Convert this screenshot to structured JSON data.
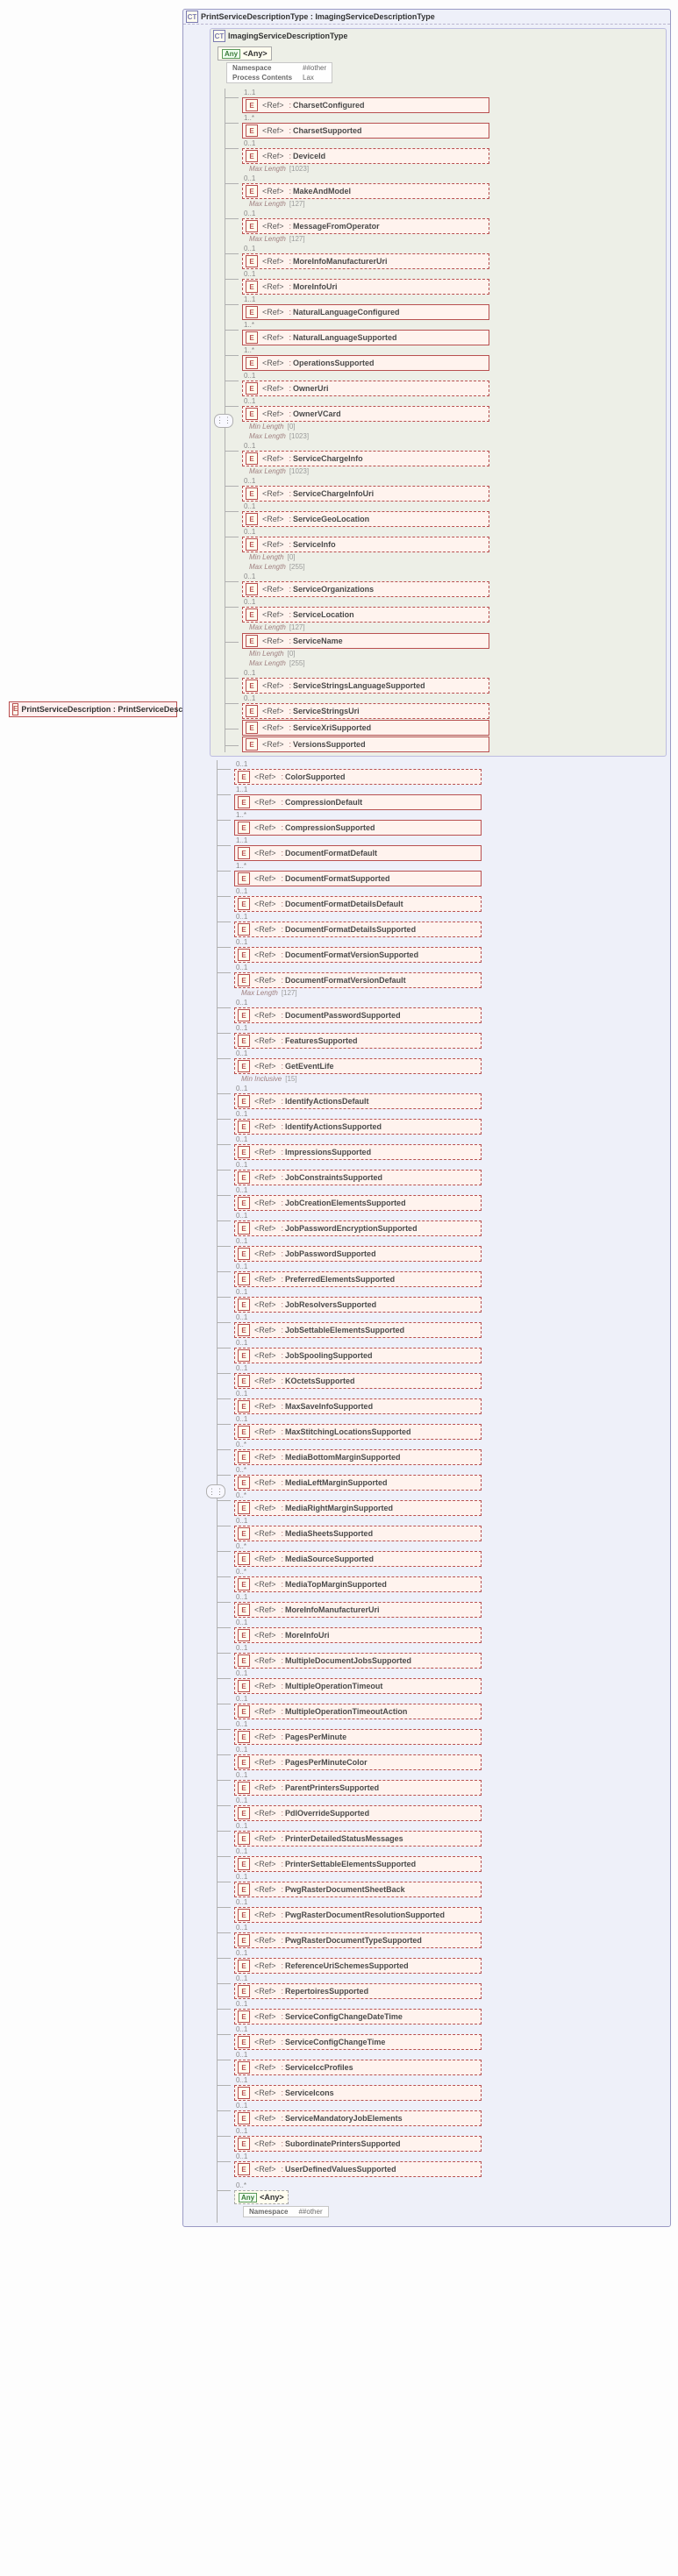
{
  "root": {
    "badge": "E",
    "label": "PrintServiceDescription : PrintServiceDescriptionType"
  },
  "outer_ct": {
    "badge": "CT",
    "title": "PrintServiceDescriptionType : ImagingServiceDescriptionType"
  },
  "inner_ct": {
    "badge": "CT",
    "title": "ImagingServiceDescriptionType"
  },
  "any_label": "<Any>",
  "any_badge": "Any",
  "ref_badge": "E",
  "ref_label": "<Ref>",
  "any_meta_top": [
    {
      "k": "Namespace",
      "v": "##other"
    },
    {
      "k": "Process Contents",
      "v": "Lax"
    }
  ],
  "any_meta_bottom": [
    {
      "k": "Namespace",
      "v": "##other"
    }
  ],
  "constraint_labels": {
    "max_length": "Max Length",
    "min_length": "Min Length",
    "min_inclusive": "Min Inclusive"
  },
  "inner_items": [
    {
      "occ": "1..1",
      "solid": true,
      "name": "CharsetConfigured"
    },
    {
      "occ": "1..*",
      "solid": true,
      "name": "CharsetSupported"
    },
    {
      "occ": "0..1",
      "solid": false,
      "name": "DeviceId",
      "constraints": [
        [
          "max_length",
          "[1023]"
        ]
      ]
    },
    {
      "occ": "0..1",
      "solid": false,
      "name": "MakeAndModel",
      "constraints": [
        [
          "max_length",
          "[127]"
        ]
      ]
    },
    {
      "occ": "0..1",
      "solid": false,
      "name": "MessageFromOperator",
      "constraints": [
        [
          "max_length",
          "[127]"
        ]
      ]
    },
    {
      "occ": "0..1",
      "solid": false,
      "name": "MoreInfoManufacturerUri"
    },
    {
      "occ": "0..1",
      "solid": false,
      "name": "MoreInfoUri"
    },
    {
      "occ": "1..1",
      "solid": true,
      "name": "NaturalLanguageConfigured"
    },
    {
      "occ": "1..*",
      "solid": true,
      "name": "NaturalLanguageSupported"
    },
    {
      "occ": "1..*",
      "solid": true,
      "name": "OperationsSupported"
    },
    {
      "occ": "0..1",
      "solid": false,
      "name": "OwnerUri"
    },
    {
      "occ": "0..1",
      "solid": false,
      "name": "OwnerVCard",
      "constraints": [
        [
          "min_length",
          "[0]"
        ],
        [
          "max_length",
          "[1023]"
        ]
      ]
    },
    {
      "occ": "0..1",
      "solid": false,
      "name": "ServiceChargeInfo",
      "constraints": [
        [
          "max_length",
          "[1023]"
        ]
      ]
    },
    {
      "occ": "0..1",
      "solid": false,
      "name": "ServiceChargeInfoUri"
    },
    {
      "occ": "0..1",
      "solid": false,
      "name": "ServiceGeoLocation"
    },
    {
      "occ": "0..1",
      "solid": false,
      "name": "ServiceInfo",
      "constraints": [
        [
          "min_length",
          "[0]"
        ],
        [
          "max_length",
          "[255]"
        ]
      ]
    },
    {
      "occ": "0..1",
      "solid": false,
      "name": "ServiceOrganizations"
    },
    {
      "occ": "0..1",
      "solid": false,
      "name": "ServiceLocation",
      "constraints": [
        [
          "max_length",
          "[127]"
        ]
      ]
    },
    {
      "occ": "",
      "solid": true,
      "name": "ServiceName",
      "constraints": [
        [
          "min_length",
          "[0]"
        ],
        [
          "max_length",
          "[255]"
        ]
      ]
    },
    {
      "occ": "0..1",
      "solid": false,
      "name": "ServiceStringsLanguageSupported"
    },
    {
      "occ": "0..1",
      "solid": false,
      "name": "ServiceStringsUri"
    },
    {
      "occ": "",
      "solid": true,
      "name": "ServiceXriSupported"
    },
    {
      "occ": "",
      "solid": true,
      "name": "VersionsSupported"
    }
  ],
  "outer_items": [
    {
      "occ": "0..1",
      "solid": false,
      "name": "ColorSupported"
    },
    {
      "occ": "1..1",
      "solid": true,
      "name": "CompressionDefault"
    },
    {
      "occ": "1..*",
      "solid": true,
      "name": "CompressionSupported"
    },
    {
      "occ": "1..1",
      "solid": true,
      "name": "DocumentFormatDefault"
    },
    {
      "occ": "1..*",
      "solid": true,
      "name": "DocumentFormatSupported"
    },
    {
      "occ": "0..1",
      "solid": false,
      "name": "DocumentFormatDetailsDefault"
    },
    {
      "occ": "0..1",
      "solid": false,
      "name": "DocumentFormatDetailsSupported"
    },
    {
      "occ": "0..1",
      "solid": false,
      "name": "DocumentFormatVersionSupported"
    },
    {
      "occ": "0..1",
      "solid": false,
      "name": "DocumentFormatVersionDefault",
      "constraints": [
        [
          "max_length",
          "[127]"
        ]
      ]
    },
    {
      "occ": "0..1",
      "solid": false,
      "name": "DocumentPasswordSupported"
    },
    {
      "occ": "0..1",
      "solid": false,
      "name": "FeaturesSupported"
    },
    {
      "occ": "0..1",
      "solid": false,
      "name": "GetEventLife",
      "constraints": [
        [
          "min_inclusive",
          "[15]"
        ]
      ]
    },
    {
      "occ": "0..1",
      "solid": false,
      "name": "IdentifyActionsDefault"
    },
    {
      "occ": "0..1",
      "solid": false,
      "name": "IdentifyActionsSupported"
    },
    {
      "occ": "0..1",
      "solid": false,
      "name": "ImpressionsSupported"
    },
    {
      "occ": "0..1",
      "solid": false,
      "name": "JobConstraintsSupported"
    },
    {
      "occ": "0..1",
      "solid": false,
      "name": "JobCreationElementsSupported"
    },
    {
      "occ": "0..1",
      "solid": false,
      "name": "JobPasswordEncryptionSupported"
    },
    {
      "occ": "0..1",
      "solid": false,
      "name": "JobPasswordSupported"
    },
    {
      "occ": "0..1",
      "solid": false,
      "name": "PreferredElementsSupported"
    },
    {
      "occ": "0..1",
      "solid": false,
      "name": "JobResolversSupported"
    },
    {
      "occ": "0..1",
      "solid": false,
      "name": "JobSettableElementsSupported"
    },
    {
      "occ": "0..1",
      "solid": false,
      "name": "JobSpoolingSupported"
    },
    {
      "occ": "0..1",
      "solid": false,
      "name": "KOctetsSupported"
    },
    {
      "occ": "0..1",
      "solid": false,
      "name": "MaxSaveInfoSupported"
    },
    {
      "occ": "0..1",
      "solid": false,
      "name": "MaxStitchingLocationsSupported"
    },
    {
      "occ": "0..*",
      "solid": false,
      "name": "MediaBottomMarginSupported"
    },
    {
      "occ": "0..*",
      "solid": false,
      "name": "MediaLeftMarginSupported"
    },
    {
      "occ": "0..*",
      "solid": false,
      "name": "MediaRightMarginSupported"
    },
    {
      "occ": "0..1",
      "solid": false,
      "name": "MediaSheetsSupported"
    },
    {
      "occ": "0..*",
      "solid": false,
      "name": "MediaSourceSupported"
    },
    {
      "occ": "0..*",
      "solid": false,
      "name": "MediaTopMarginSupported"
    },
    {
      "occ": "0..1",
      "solid": false,
      "name": "MoreInfoManufacturerUri"
    },
    {
      "occ": "0..1",
      "solid": false,
      "name": "MoreInfoUri"
    },
    {
      "occ": "0..1",
      "solid": false,
      "name": "MultipleDocumentJobsSupported"
    },
    {
      "occ": "0..1",
      "solid": false,
      "name": "MultipleOperationTimeout"
    },
    {
      "occ": "0..1",
      "solid": false,
      "name": "MultipleOperationTimeoutAction"
    },
    {
      "occ": "0..1",
      "solid": false,
      "name": "PagesPerMinute"
    },
    {
      "occ": "0..1",
      "solid": false,
      "name": "PagesPerMinuteColor"
    },
    {
      "occ": "0..1",
      "solid": false,
      "name": "ParentPrintersSupported"
    },
    {
      "occ": "0..1",
      "solid": false,
      "name": "PdlOverrideSupported"
    },
    {
      "occ": "0..1",
      "solid": false,
      "name": "PrinterDetailedStatusMessages"
    },
    {
      "occ": "0..1",
      "solid": false,
      "name": "PrinterSettableElementsSupported"
    },
    {
      "occ": "0..1",
      "solid": false,
      "name": "PwgRasterDocumentSheetBack"
    },
    {
      "occ": "0..1",
      "solid": false,
      "name": "PwgRasterDocumentResolutionSupported"
    },
    {
      "occ": "0..1",
      "solid": false,
      "name": "PwgRasterDocumentTypeSupported"
    },
    {
      "occ": "0..1",
      "solid": false,
      "name": "ReferenceUriSchemesSupported"
    },
    {
      "occ": "0..1",
      "solid": false,
      "name": "RepertoiresSupported"
    },
    {
      "occ": "0..1",
      "solid": false,
      "name": "ServiceConfigChangeDateTime"
    },
    {
      "occ": "0..1",
      "solid": false,
      "name": "ServiceConfigChangeTime"
    },
    {
      "occ": "0..1",
      "solid": false,
      "name": "ServiceIccProfiles"
    },
    {
      "occ": "0..1",
      "solid": false,
      "name": "ServiceIcons"
    },
    {
      "occ": "0..1",
      "solid": false,
      "name": "ServiceMandatoryJobElements"
    },
    {
      "occ": "0..1",
      "solid": false,
      "name": "SubordinatePrintersSupported"
    },
    {
      "occ": "0..1",
      "solid": false,
      "name": "UserDefinedValuesSupported"
    }
  ],
  "bottom_any_occ": "0..*",
  "compositor_glyph": "⋮⋮"
}
